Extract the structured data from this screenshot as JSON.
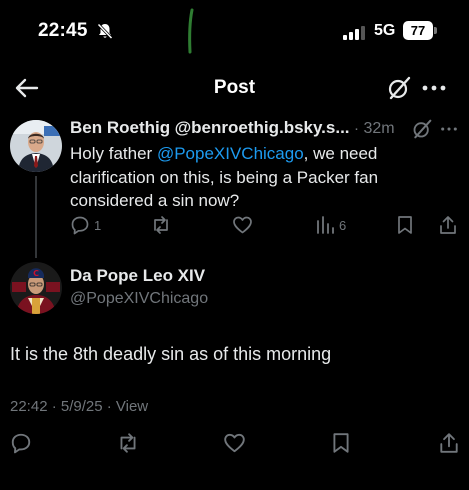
{
  "status_bar": {
    "time": "22:45",
    "network": "5G",
    "battery": "77",
    "icons": [
      "bell-slash-icon",
      "signal-icon",
      "battery-icon"
    ]
  },
  "nav": {
    "title": "Post",
    "icons": [
      "back-arrow-icon",
      "grok-icon",
      "more-icon"
    ]
  },
  "parent_tweet": {
    "display_name": "Ben Roethig",
    "handle": "@benroethig.bsky.s...",
    "separator": "·",
    "age": "32m",
    "text_before": "Holy father ",
    "mention": "@PopeXIVChicago",
    "text_after": ", we need clarification on this, is being a Packer fan considered a sin now?",
    "replies": "1",
    "reposts": "",
    "likes": "",
    "views": "6"
  },
  "main_tweet": {
    "display_name": "Da Pope Leo XIV",
    "handle": "@PopeXIVChicago",
    "text": "It is the 8th deadly sin as of this morning",
    "meta": "22:42 · 5/9/25 · View"
  },
  "colors": {
    "background": "#000000",
    "text_primary": "#e7e9ea",
    "text_secondary": "#71767b",
    "link": "#1d9bf0",
    "divider": "#333639"
  }
}
